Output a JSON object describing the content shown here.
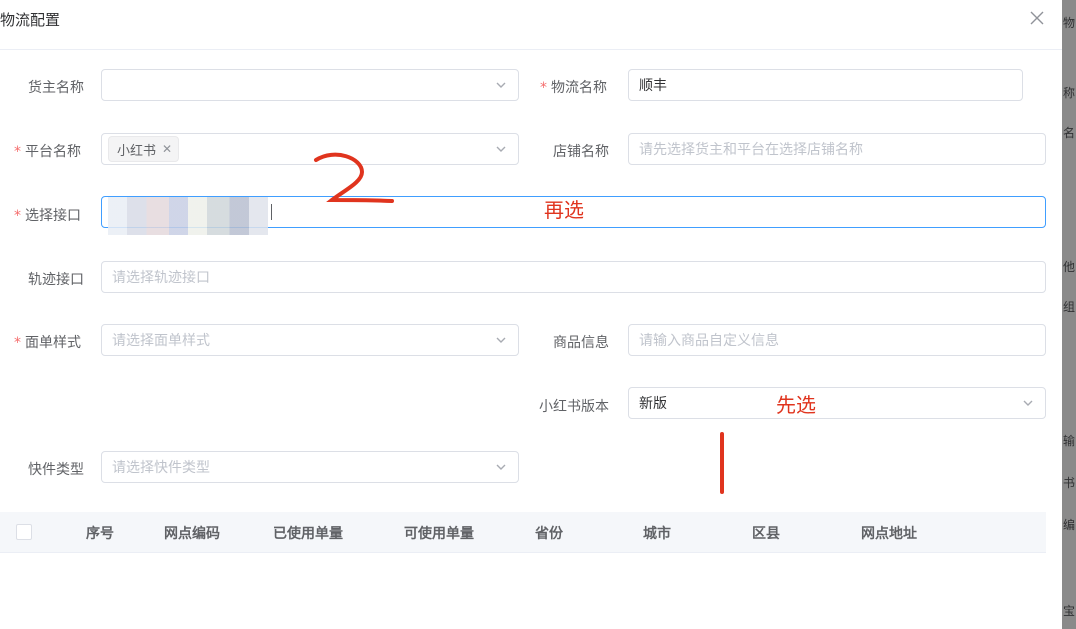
{
  "dialog": {
    "title": "物流配置"
  },
  "form": {
    "owner": {
      "label": "货主名称",
      "value": ""
    },
    "logistics": {
      "label": "物流名称",
      "value": "顺丰"
    },
    "platform": {
      "label": "平台名称",
      "tag": "小红书"
    },
    "shop": {
      "label": "店铺名称",
      "placeholder": "请先选择货主和平台在选择店铺名称"
    },
    "api": {
      "label": "选择接口"
    },
    "track": {
      "label": "轨迹接口",
      "placeholder": "请选择轨迹接口"
    },
    "waybill": {
      "label": "面单样式",
      "placeholder": "请选择面单样式"
    },
    "goods": {
      "label": "商品信息",
      "placeholder": "请输入商品自定义信息"
    },
    "xhs_version": {
      "label": "小红书版本",
      "value": "新版"
    },
    "express_type": {
      "label": "快件类型",
      "placeholder": "请选择快件类型"
    }
  },
  "annotations": {
    "then_select": "再选",
    "first_select": "先选"
  },
  "table": {
    "columns": [
      "序号",
      "网点编码",
      "已使用单量",
      "可使用单量",
      "省份",
      "城市",
      "区县",
      "网点地址"
    ]
  },
  "side": {
    "chars": [
      "物",
      "称",
      "名",
      "他",
      "组",
      "输",
      "书",
      "编",
      "宝"
    ]
  },
  "colors": {
    "required": "#f56c6c",
    "focus": "#409eff",
    "annotation": "#e0341e"
  }
}
